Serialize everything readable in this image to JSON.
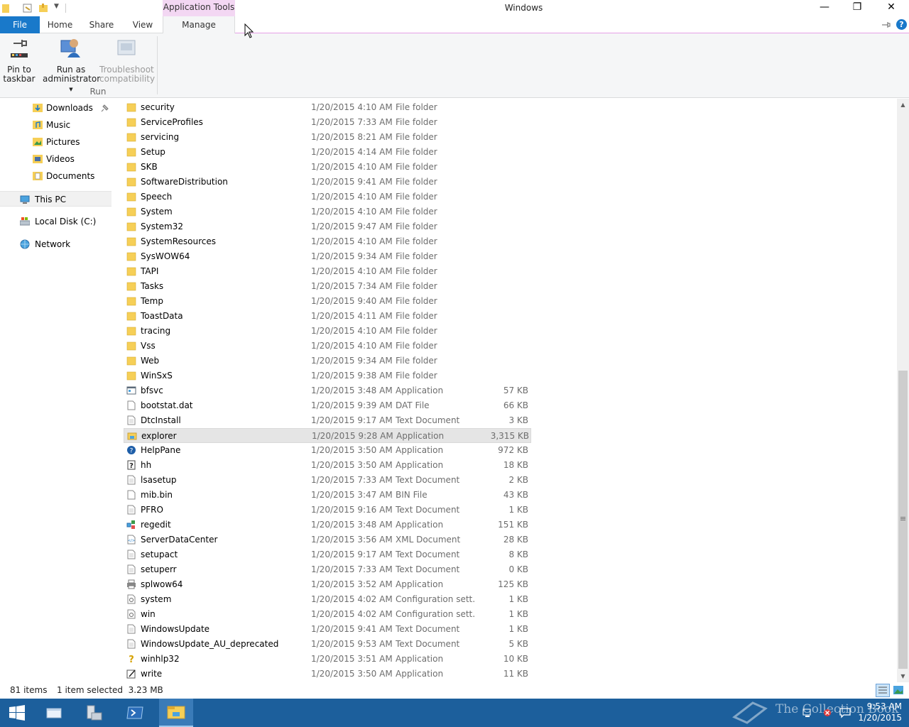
{
  "window": {
    "title": "Windows",
    "contextual_tab_header": "Application Tools",
    "minimize_glyph": "—",
    "restore_glyph": "❐",
    "close_glyph": "✕"
  },
  "ribbon": {
    "tabs": {
      "file": "File",
      "home": "Home",
      "share": "Share",
      "view": "View",
      "manage": "Manage"
    },
    "buttons": {
      "pin_line1": "Pin to",
      "pin_line2": "taskbar",
      "runas_line1": "Run as",
      "runas_line2": "administrator",
      "trouble_line1": "Troubleshoot",
      "trouble_line2": "compatibility"
    },
    "group_label": "Run",
    "help_glyph": "?"
  },
  "nav": {
    "quick_access": [
      {
        "label": "Downloads",
        "icon": "downloads-folder-icon"
      },
      {
        "label": "Music",
        "icon": "music-folder-icon"
      },
      {
        "label": "Pictures",
        "icon": "pictures-folder-icon"
      },
      {
        "label": "Videos",
        "icon": "videos-folder-icon"
      },
      {
        "label": "Documents",
        "icon": "documents-folder-icon"
      }
    ],
    "this_pc": "This PC",
    "local_disk": "Local Disk (C:)",
    "network": "Network"
  },
  "files": [
    {
      "name": "security",
      "date": "1/20/2015 4:10 AM",
      "type": "File folder",
      "size": "",
      "icon": "folder"
    },
    {
      "name": "ServiceProfiles",
      "date": "1/20/2015 7:33 AM",
      "type": "File folder",
      "size": "",
      "icon": "folder"
    },
    {
      "name": "servicing",
      "date": "1/20/2015 8:21 AM",
      "type": "File folder",
      "size": "",
      "icon": "folder"
    },
    {
      "name": "Setup",
      "date": "1/20/2015 4:14 AM",
      "type": "File folder",
      "size": "",
      "icon": "folder"
    },
    {
      "name": "SKB",
      "date": "1/20/2015 4:10 AM",
      "type": "File folder",
      "size": "",
      "icon": "folder"
    },
    {
      "name": "SoftwareDistribution",
      "date": "1/20/2015 9:41 AM",
      "type": "File folder",
      "size": "",
      "icon": "folder"
    },
    {
      "name": "Speech",
      "date": "1/20/2015 4:10 AM",
      "type": "File folder",
      "size": "",
      "icon": "folder"
    },
    {
      "name": "System",
      "date": "1/20/2015 4:10 AM",
      "type": "File folder",
      "size": "",
      "icon": "folder"
    },
    {
      "name": "System32",
      "date": "1/20/2015 9:47 AM",
      "type": "File folder",
      "size": "",
      "icon": "folder"
    },
    {
      "name": "SystemResources",
      "date": "1/20/2015 4:10 AM",
      "type": "File folder",
      "size": "",
      "icon": "folder"
    },
    {
      "name": "SysWOW64",
      "date": "1/20/2015 9:34 AM",
      "type": "File folder",
      "size": "",
      "icon": "folder"
    },
    {
      "name": "TAPI",
      "date": "1/20/2015 4:10 AM",
      "type": "File folder",
      "size": "",
      "icon": "folder"
    },
    {
      "name": "Tasks",
      "date": "1/20/2015 7:34 AM",
      "type": "File folder",
      "size": "",
      "icon": "folder"
    },
    {
      "name": "Temp",
      "date": "1/20/2015 9:40 AM",
      "type": "File folder",
      "size": "",
      "icon": "folder"
    },
    {
      "name": "ToastData",
      "date": "1/20/2015 4:11 AM",
      "type": "File folder",
      "size": "",
      "icon": "folder"
    },
    {
      "name": "tracing",
      "date": "1/20/2015 4:10 AM",
      "type": "File folder",
      "size": "",
      "icon": "folder"
    },
    {
      "name": "Vss",
      "date": "1/20/2015 4:10 AM",
      "type": "File folder",
      "size": "",
      "icon": "folder"
    },
    {
      "name": "Web",
      "date": "1/20/2015 9:34 AM",
      "type": "File folder",
      "size": "",
      "icon": "folder"
    },
    {
      "name": "WinSxS",
      "date": "1/20/2015 9:38 AM",
      "type": "File folder",
      "size": "",
      "icon": "folder"
    },
    {
      "name": "bfsvc",
      "date": "1/20/2015 3:48 AM",
      "type": "Application",
      "size": "57 KB",
      "icon": "app"
    },
    {
      "name": "bootstat.dat",
      "date": "1/20/2015 9:39 AM",
      "type": "DAT File",
      "size": "66 KB",
      "icon": "file"
    },
    {
      "name": "DtcInstall",
      "date": "1/20/2015 9:17 AM",
      "type": "Text Document",
      "size": "3 KB",
      "icon": "text"
    },
    {
      "name": "explorer",
      "date": "1/20/2015 9:28 AM",
      "type": "Application",
      "size": "3,315 KB",
      "icon": "explorer",
      "selected": true
    },
    {
      "name": "HelpPane",
      "date": "1/20/2015 3:50 AM",
      "type": "Application",
      "size": "972 KB",
      "icon": "help"
    },
    {
      "name": "hh",
      "date": "1/20/2015 3:50 AM",
      "type": "Application",
      "size": "18 KB",
      "icon": "hh"
    },
    {
      "name": "lsasetup",
      "date": "1/20/2015 7:33 AM",
      "type": "Text Document",
      "size": "2 KB",
      "icon": "text"
    },
    {
      "name": "mib.bin",
      "date": "1/20/2015 3:47 AM",
      "type": "BIN File",
      "size": "43 KB",
      "icon": "file"
    },
    {
      "name": "PFRO",
      "date": "1/20/2015 9:16 AM",
      "type": "Text Document",
      "size": "1 KB",
      "icon": "text"
    },
    {
      "name": "regedit",
      "date": "1/20/2015 3:48 AM",
      "type": "Application",
      "size": "151 KB",
      "icon": "regedit"
    },
    {
      "name": "ServerDataCenter",
      "date": "1/20/2015 3:56 AM",
      "type": "XML Document",
      "size": "28 KB",
      "icon": "xml"
    },
    {
      "name": "setupact",
      "date": "1/20/2015 9:17 AM",
      "type": "Text Document",
      "size": "8 KB",
      "icon": "text"
    },
    {
      "name": "setuperr",
      "date": "1/20/2015 7:33 AM",
      "type": "Text Document",
      "size": "0 KB",
      "icon": "text"
    },
    {
      "name": "splwow64",
      "date": "1/20/2015 3:52 AM",
      "type": "Application",
      "size": "125 KB",
      "icon": "printer"
    },
    {
      "name": "system",
      "date": "1/20/2015 4:02 AM",
      "type": "Configuration sett...",
      "size": "1 KB",
      "icon": "config"
    },
    {
      "name": "win",
      "date": "1/20/2015 4:02 AM",
      "type": "Configuration sett...",
      "size": "1 KB",
      "icon": "config"
    },
    {
      "name": "WindowsUpdate",
      "date": "1/20/2015 9:41 AM",
      "type": "Text Document",
      "size": "1 KB",
      "icon": "text"
    },
    {
      "name": "WindowsUpdate_AU_deprecated",
      "date": "1/20/2015 9:53 AM",
      "type": "Text Document",
      "size": "5 KB",
      "icon": "text"
    },
    {
      "name": "winhlp32",
      "date": "1/20/2015 3:51 AM",
      "type": "Application",
      "size": "10 KB",
      "icon": "winhlp"
    },
    {
      "name": "write",
      "date": "1/20/2015 3:50 AM",
      "type": "Application",
      "size": "11 KB",
      "icon": "write"
    }
  ],
  "status": {
    "item_count": "81 items",
    "selection": "1 item selected  3.23 MB"
  },
  "taskbar": {
    "time": "9:53 AM",
    "date": "1/20/2015",
    "watermark": "The Collection Book"
  },
  "colors": {
    "accent": "#1979ca",
    "folder": "#f6cf57",
    "taskbar": "#1c5f9c",
    "contextual": "#f3d7f3"
  }
}
